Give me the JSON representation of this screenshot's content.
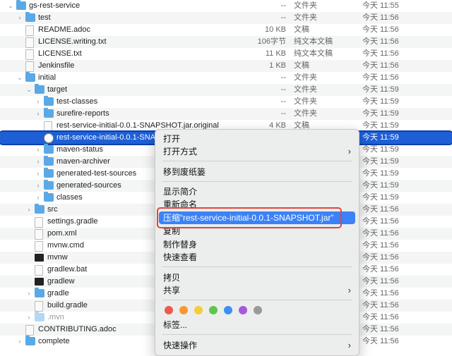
{
  "files": [
    {
      "name": "gs-rest-service",
      "size": "--",
      "kind": "文件夹",
      "date": "今天 11:55",
      "icon": "folder",
      "chevron": "down"
    },
    {
      "name": "test",
      "size": "--",
      "kind": "文件夹",
      "date": "今天 11:56",
      "icon": "folder",
      "chevron": "right"
    },
    {
      "name": "README.adoc",
      "size": "10 KB",
      "kind": "文稿",
      "date": "今天 11:56",
      "icon": "doc"
    },
    {
      "name": "LICENSE.writing.txt",
      "size": "106字节",
      "kind": "纯文本文稿",
      "date": "今天 11:56",
      "icon": "doc"
    },
    {
      "name": "LICENSE.txt",
      "size": "11 KB",
      "kind": "纯文本文稿",
      "date": "今天 11:56",
      "icon": "doc"
    },
    {
      "name": "Jenkinsfile",
      "size": "1 KB",
      "kind": "文稿",
      "date": "今天 11:56",
      "icon": "doc"
    },
    {
      "name": "initial",
      "size": "--",
      "kind": "文件夹",
      "date": "今天 11:56",
      "icon": "folder",
      "chevron": "down"
    },
    {
      "name": "target",
      "size": "--",
      "kind": "文件夹",
      "date": "今天 11:59",
      "icon": "folder",
      "chevron": "down"
    },
    {
      "name": "test-classes",
      "size": "--",
      "kind": "文件夹",
      "date": "今天 11:59",
      "icon": "folder",
      "chevron": "right"
    },
    {
      "name": "surefire-reports",
      "size": "--",
      "kind": "文件夹",
      "date": "今天 11:59",
      "icon": "folder",
      "chevron": "right"
    },
    {
      "name": "rest-service-initial-0.0.1-SNAPSHOT.jar.original",
      "size": "4 KB",
      "kind": "文稿",
      "date": "今天 11:59",
      "icon": "doc"
    },
    {
      "name": "rest-service-initial-0.0.1-SNA",
      "size": "",
      "kind": "",
      "date": "今天 11:59",
      "icon": "jar",
      "selected": true
    },
    {
      "name": "maven-status",
      "size": "",
      "kind": "",
      "date": "今天 11:59",
      "icon": "folder",
      "chevron": "right"
    },
    {
      "name": "maven-archiver",
      "size": "",
      "kind": "",
      "date": "今天 11:59",
      "icon": "folder",
      "chevron": "right"
    },
    {
      "name": "generated-test-sources",
      "size": "",
      "kind": "",
      "date": "今天 11:59",
      "icon": "folder",
      "chevron": "right"
    },
    {
      "name": "generated-sources",
      "size": "",
      "kind": "",
      "date": "今天 11:59",
      "icon": "folder",
      "chevron": "right"
    },
    {
      "name": "classes",
      "size": "",
      "kind": "",
      "date": "今天 11:59",
      "icon": "folder",
      "chevron": "right"
    },
    {
      "name": "src",
      "size": "",
      "kind": "",
      "date": "今天 11:56",
      "icon": "folder",
      "chevron": "right"
    },
    {
      "name": "settings.gradle",
      "size": "",
      "kind": "",
      "date": "今天 11:56",
      "icon": "doc"
    },
    {
      "name": "pom.xml",
      "size": "",
      "kind": "",
      "date": "今天 11:56",
      "icon": "doc"
    },
    {
      "name": "mvnw.cmd",
      "size": "",
      "kind": "",
      "date": "今天 11:56",
      "icon": "doc"
    },
    {
      "name": "mvnw",
      "size": "",
      "kind": "",
      "date": "今天 11:56",
      "icon": "exec"
    },
    {
      "name": "gradlew.bat",
      "size": "",
      "kind": "",
      "date": "今天 11:56",
      "icon": "doc"
    },
    {
      "name": "gradlew",
      "size": "",
      "kind": "",
      "date": "今天 11:56",
      "icon": "exec"
    },
    {
      "name": "gradle",
      "size": "",
      "kind": "",
      "date": "今天 11:56",
      "icon": "folder",
      "chevron": "right"
    },
    {
      "name": "build.gradle",
      "size": "",
      "kind": "",
      "date": "今天 11:56",
      "icon": "doc"
    },
    {
      "name": ".mvn",
      "size": "",
      "kind": "",
      "date": "今天 11:56",
      "icon": "folder-dim",
      "chevron": "right",
      "dim": true
    },
    {
      "name": "CONTRIBUTING.adoc",
      "size": "",
      "kind": "",
      "date": "今天 11:56",
      "icon": "doc"
    },
    {
      "name": "complete",
      "size": "",
      "kind": "",
      "date": "今天 11:56",
      "icon": "folder",
      "chevron": "right"
    }
  ],
  "context_menu": {
    "open": "打开",
    "open_with": "打开方式",
    "move_to_trash": "移到废纸篓",
    "get_info": "显示简介",
    "rename": "重新命名",
    "compress": "压缩“rest-service-initial-0.0.1-SNAPSHOT.jar”",
    "copy": "复制",
    "make_alias": "制作替身",
    "quick_look": "快速查看",
    "copy_item": "拷贝",
    "share": "共享",
    "tags": "标签...",
    "quick_actions": "快速操作"
  },
  "tag_colors": [
    "#ee5a52",
    "#f39a33",
    "#f4cd3a",
    "#5ec54a",
    "#3b8ff5",
    "#a45ad9",
    "#9a9a9a"
  ]
}
